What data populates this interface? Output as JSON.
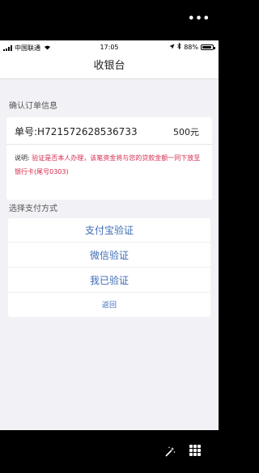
{
  "overlay": {
    "more_label": "•••"
  },
  "status_bar": {
    "carrier": "中国联通",
    "time": "17:05",
    "battery_text": "88%",
    "battery_level": 0.88,
    "icons": [
      "signal-icon",
      "wifi-icon",
      "location-icon",
      "bluetooth-icon",
      "battery-icon"
    ]
  },
  "nav": {
    "title": "收银台"
  },
  "order_section": {
    "label": "确认订单信息",
    "order_number": "单号:H721572628536733",
    "amount": "500元",
    "note_prefix": "说明:",
    "note_text": "验证是否本人办理，该笔资金将与您的贷款金额一同下放至银行卡(尾号0303)"
  },
  "payment_section": {
    "label": "选择支付方式",
    "options": [
      "支付宝验证",
      "微信验证",
      "我已验证"
    ],
    "back_label": "返回"
  },
  "colors": {
    "accent": "#3d6cb7",
    "warning": "#d5284c",
    "background": "#f2f2f6"
  }
}
